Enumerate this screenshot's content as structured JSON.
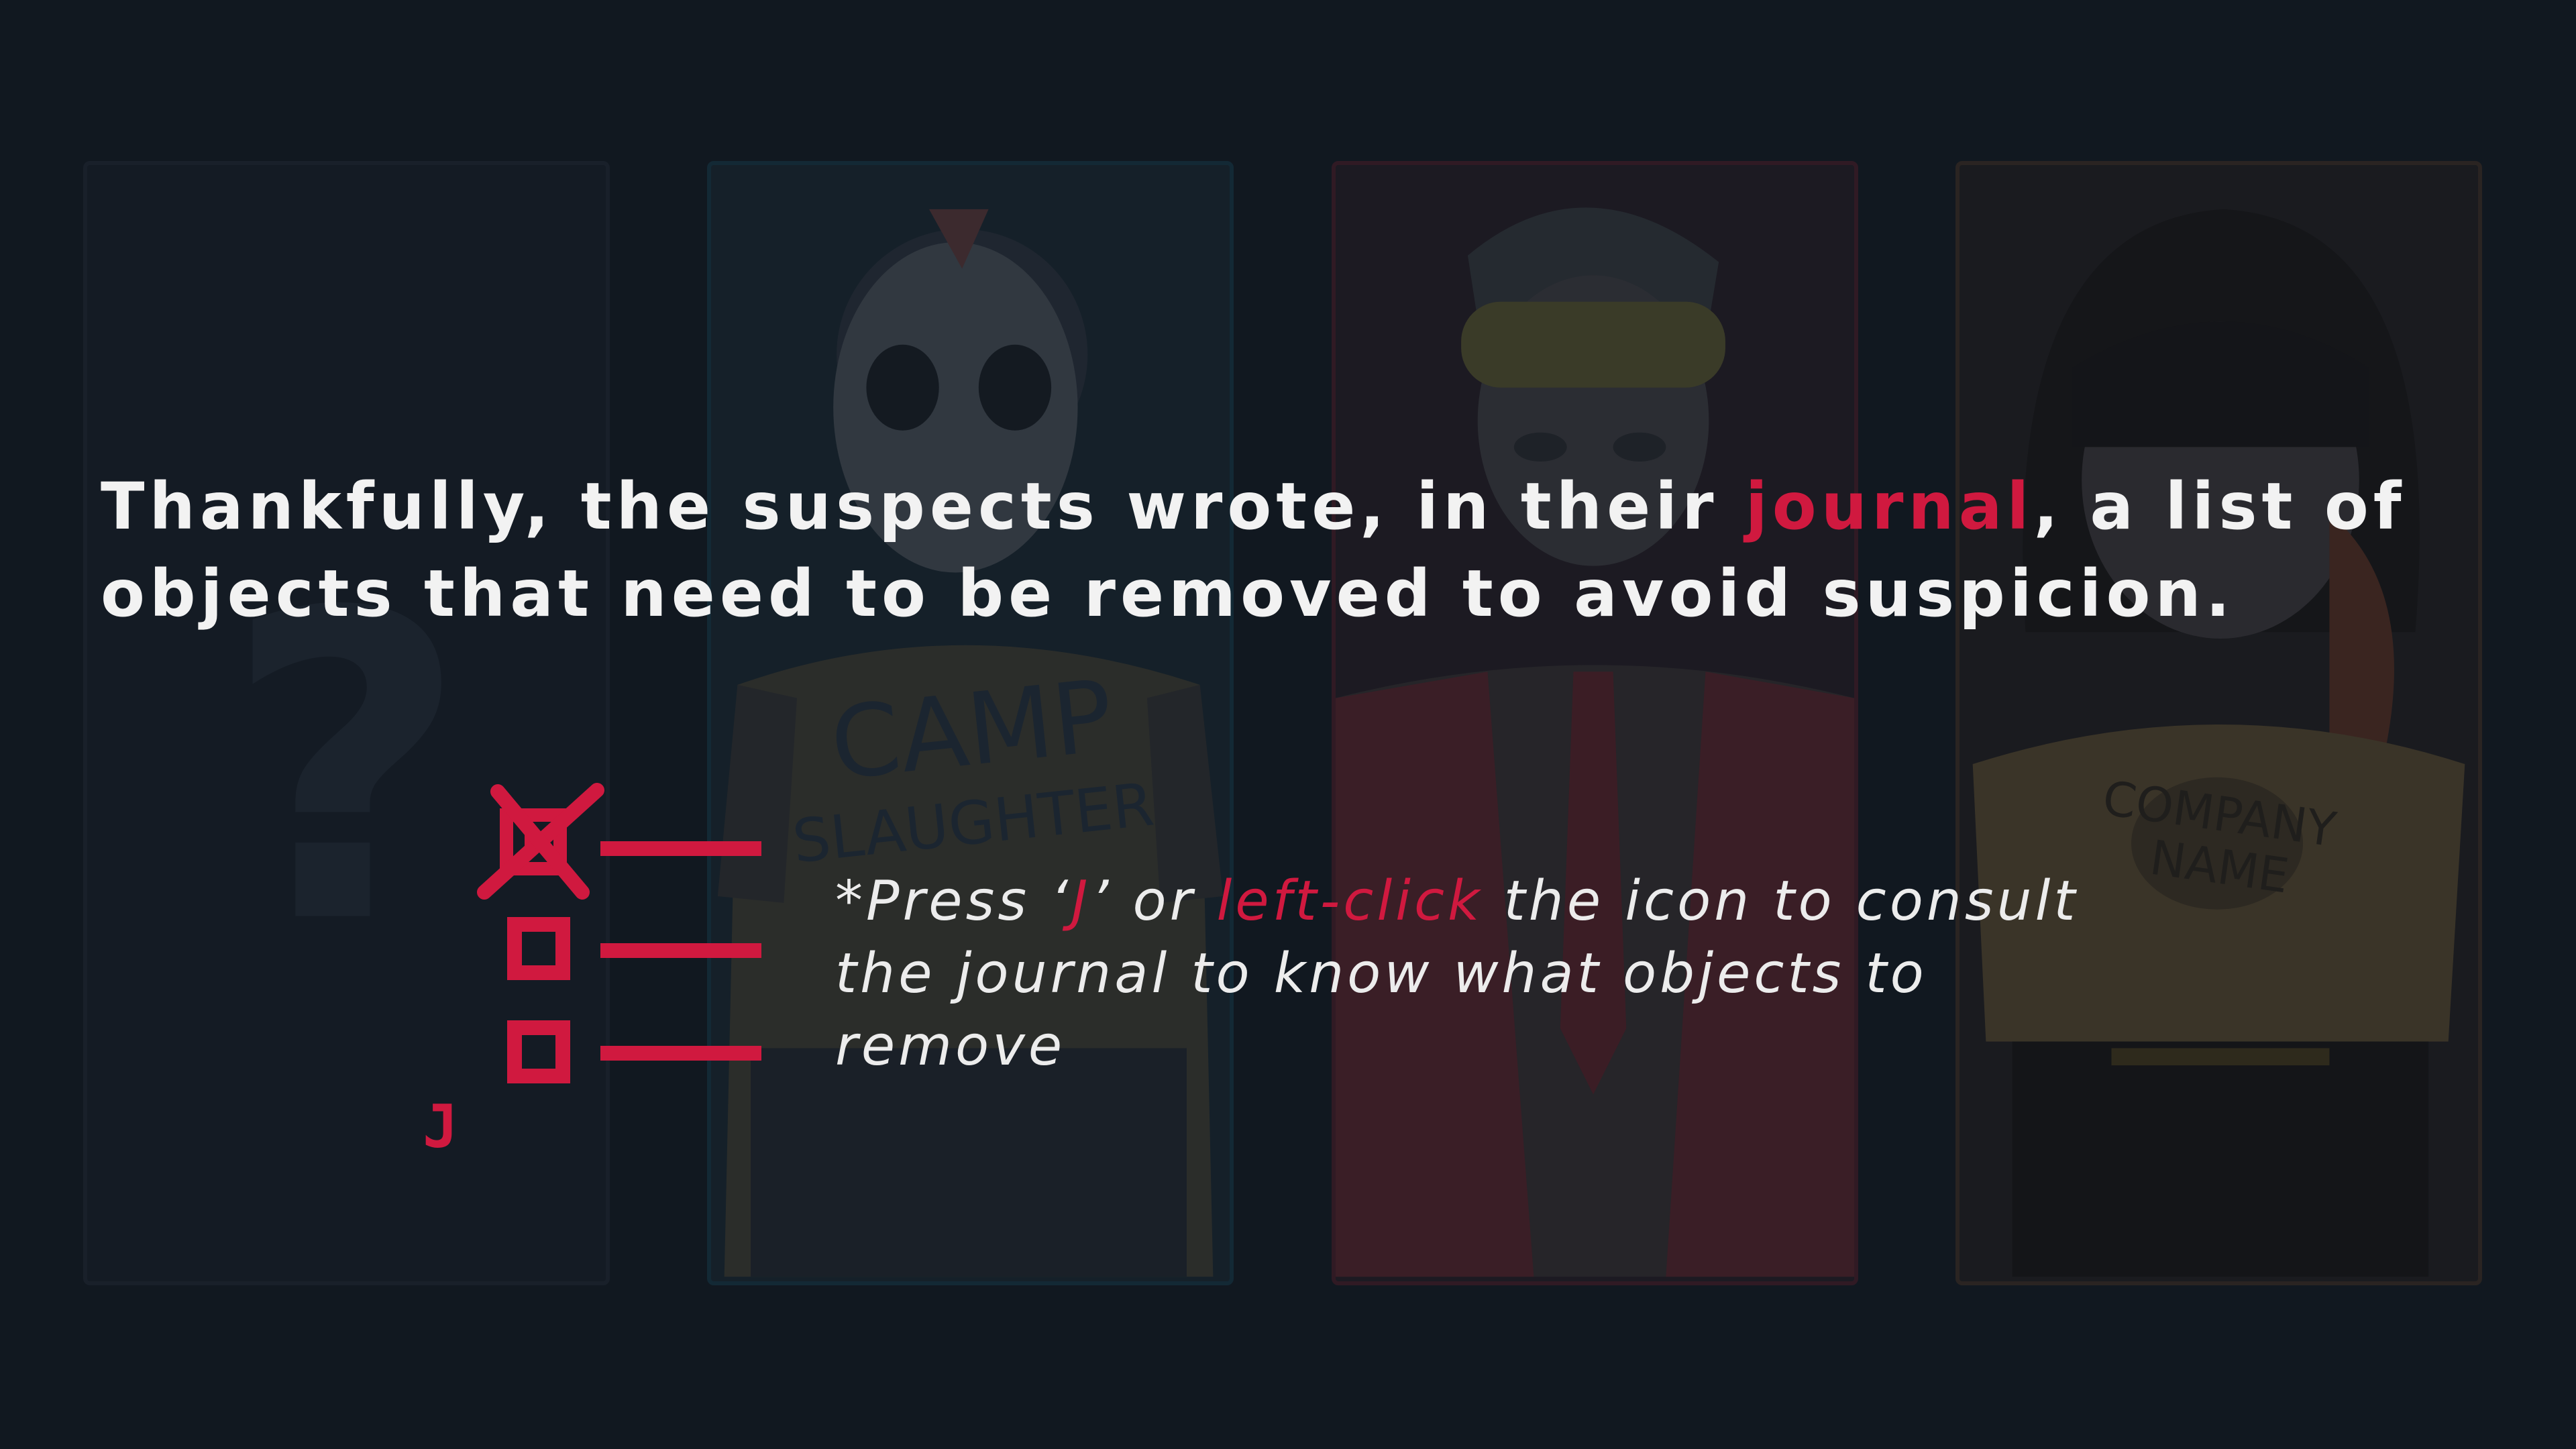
{
  "colors": {
    "background": "#111820",
    "accent": "#d0193f",
    "text": "#f2f2f2"
  },
  "background_cards": [
    {
      "name": "unknown-suspect",
      "glyph": "?"
    },
    {
      "name": "hockey-mask-suspect",
      "shirt_text_line1": "CAMP",
      "shirt_text_line2": "SLAUGHTER"
    },
    {
      "name": "goggles-suspect"
    },
    {
      "name": "hooded-suspect",
      "shirt_text_line1": "COMPANY",
      "shirt_text_line2": "NAME"
    }
  ],
  "narration": {
    "part1": "Thankfully, the suspects wrote, in their ",
    "highlight": "journal",
    "part2": ", a list of objects that need to be removed to avoid suspicion."
  },
  "journal_button": {
    "icon": "checklist-icon",
    "key_label": "J"
  },
  "hint": {
    "prefix": "*Press ‘",
    "key": "J",
    "middle": "’ or ",
    "action": "left-click",
    "suffix": " the icon to consult the journal to know what objects to remove"
  }
}
